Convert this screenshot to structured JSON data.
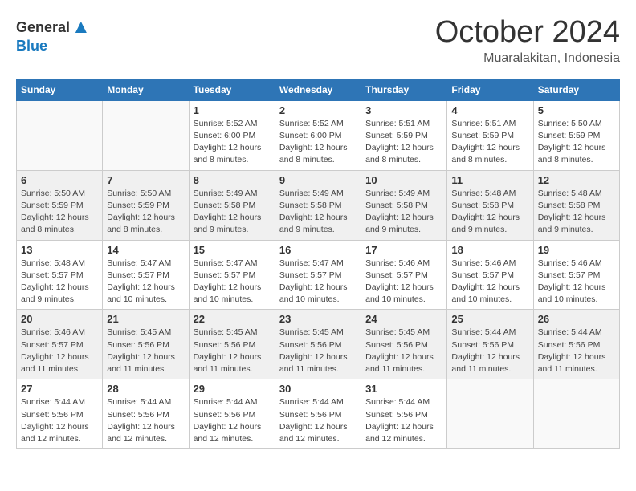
{
  "header": {
    "logo_general": "General",
    "logo_blue": "Blue",
    "month": "October 2024",
    "location": "Muaralakitan, Indonesia"
  },
  "weekdays": [
    "Sunday",
    "Monday",
    "Tuesday",
    "Wednesday",
    "Thursday",
    "Friday",
    "Saturday"
  ],
  "weeks": [
    [
      {
        "day": "",
        "sunrise": "",
        "sunset": "",
        "daylight": ""
      },
      {
        "day": "",
        "sunrise": "",
        "sunset": "",
        "daylight": ""
      },
      {
        "day": "1",
        "sunrise": "Sunrise: 5:52 AM",
        "sunset": "Sunset: 6:00 PM",
        "daylight": "Daylight: 12 hours and 8 minutes."
      },
      {
        "day": "2",
        "sunrise": "Sunrise: 5:52 AM",
        "sunset": "Sunset: 6:00 PM",
        "daylight": "Daylight: 12 hours and 8 minutes."
      },
      {
        "day": "3",
        "sunrise": "Sunrise: 5:51 AM",
        "sunset": "Sunset: 5:59 PM",
        "daylight": "Daylight: 12 hours and 8 minutes."
      },
      {
        "day": "4",
        "sunrise": "Sunrise: 5:51 AM",
        "sunset": "Sunset: 5:59 PM",
        "daylight": "Daylight: 12 hours and 8 minutes."
      },
      {
        "day": "5",
        "sunrise": "Sunrise: 5:50 AM",
        "sunset": "Sunset: 5:59 PM",
        "daylight": "Daylight: 12 hours and 8 minutes."
      }
    ],
    [
      {
        "day": "6",
        "sunrise": "Sunrise: 5:50 AM",
        "sunset": "Sunset: 5:59 PM",
        "daylight": "Daylight: 12 hours and 8 minutes."
      },
      {
        "day": "7",
        "sunrise": "Sunrise: 5:50 AM",
        "sunset": "Sunset: 5:59 PM",
        "daylight": "Daylight: 12 hours and 8 minutes."
      },
      {
        "day": "8",
        "sunrise": "Sunrise: 5:49 AM",
        "sunset": "Sunset: 5:58 PM",
        "daylight": "Daylight: 12 hours and 9 minutes."
      },
      {
        "day": "9",
        "sunrise": "Sunrise: 5:49 AM",
        "sunset": "Sunset: 5:58 PM",
        "daylight": "Daylight: 12 hours and 9 minutes."
      },
      {
        "day": "10",
        "sunrise": "Sunrise: 5:49 AM",
        "sunset": "Sunset: 5:58 PM",
        "daylight": "Daylight: 12 hours and 9 minutes."
      },
      {
        "day": "11",
        "sunrise": "Sunrise: 5:48 AM",
        "sunset": "Sunset: 5:58 PM",
        "daylight": "Daylight: 12 hours and 9 minutes."
      },
      {
        "day": "12",
        "sunrise": "Sunrise: 5:48 AM",
        "sunset": "Sunset: 5:58 PM",
        "daylight": "Daylight: 12 hours and 9 minutes."
      }
    ],
    [
      {
        "day": "13",
        "sunrise": "Sunrise: 5:48 AM",
        "sunset": "Sunset: 5:57 PM",
        "daylight": "Daylight: 12 hours and 9 minutes."
      },
      {
        "day": "14",
        "sunrise": "Sunrise: 5:47 AM",
        "sunset": "Sunset: 5:57 PM",
        "daylight": "Daylight: 12 hours and 10 minutes."
      },
      {
        "day": "15",
        "sunrise": "Sunrise: 5:47 AM",
        "sunset": "Sunset: 5:57 PM",
        "daylight": "Daylight: 12 hours and 10 minutes."
      },
      {
        "day": "16",
        "sunrise": "Sunrise: 5:47 AM",
        "sunset": "Sunset: 5:57 PM",
        "daylight": "Daylight: 12 hours and 10 minutes."
      },
      {
        "day": "17",
        "sunrise": "Sunrise: 5:46 AM",
        "sunset": "Sunset: 5:57 PM",
        "daylight": "Daylight: 12 hours and 10 minutes."
      },
      {
        "day": "18",
        "sunrise": "Sunrise: 5:46 AM",
        "sunset": "Sunset: 5:57 PM",
        "daylight": "Daylight: 12 hours and 10 minutes."
      },
      {
        "day": "19",
        "sunrise": "Sunrise: 5:46 AM",
        "sunset": "Sunset: 5:57 PM",
        "daylight": "Daylight: 12 hours and 10 minutes."
      }
    ],
    [
      {
        "day": "20",
        "sunrise": "Sunrise: 5:46 AM",
        "sunset": "Sunset: 5:57 PM",
        "daylight": "Daylight: 12 hours and 11 minutes."
      },
      {
        "day": "21",
        "sunrise": "Sunrise: 5:45 AM",
        "sunset": "Sunset: 5:56 PM",
        "daylight": "Daylight: 12 hours and 11 minutes."
      },
      {
        "day": "22",
        "sunrise": "Sunrise: 5:45 AM",
        "sunset": "Sunset: 5:56 PM",
        "daylight": "Daylight: 12 hours and 11 minutes."
      },
      {
        "day": "23",
        "sunrise": "Sunrise: 5:45 AM",
        "sunset": "Sunset: 5:56 PM",
        "daylight": "Daylight: 12 hours and 11 minutes."
      },
      {
        "day": "24",
        "sunrise": "Sunrise: 5:45 AM",
        "sunset": "Sunset: 5:56 PM",
        "daylight": "Daylight: 12 hours and 11 minutes."
      },
      {
        "day": "25",
        "sunrise": "Sunrise: 5:44 AM",
        "sunset": "Sunset: 5:56 PM",
        "daylight": "Daylight: 12 hours and 11 minutes."
      },
      {
        "day": "26",
        "sunrise": "Sunrise: 5:44 AM",
        "sunset": "Sunset: 5:56 PM",
        "daylight": "Daylight: 12 hours and 11 minutes."
      }
    ],
    [
      {
        "day": "27",
        "sunrise": "Sunrise: 5:44 AM",
        "sunset": "Sunset: 5:56 PM",
        "daylight": "Daylight: 12 hours and 12 minutes."
      },
      {
        "day": "28",
        "sunrise": "Sunrise: 5:44 AM",
        "sunset": "Sunset: 5:56 PM",
        "daylight": "Daylight: 12 hours and 12 minutes."
      },
      {
        "day": "29",
        "sunrise": "Sunrise: 5:44 AM",
        "sunset": "Sunset: 5:56 PM",
        "daylight": "Daylight: 12 hours and 12 minutes."
      },
      {
        "day": "30",
        "sunrise": "Sunrise: 5:44 AM",
        "sunset": "Sunset: 5:56 PM",
        "daylight": "Daylight: 12 hours and 12 minutes."
      },
      {
        "day": "31",
        "sunrise": "Sunrise: 5:44 AM",
        "sunset": "Sunset: 5:56 PM",
        "daylight": "Daylight: 12 hours and 12 minutes."
      },
      {
        "day": "",
        "sunrise": "",
        "sunset": "",
        "daylight": ""
      },
      {
        "day": "",
        "sunrise": "",
        "sunset": "",
        "daylight": ""
      }
    ]
  ]
}
